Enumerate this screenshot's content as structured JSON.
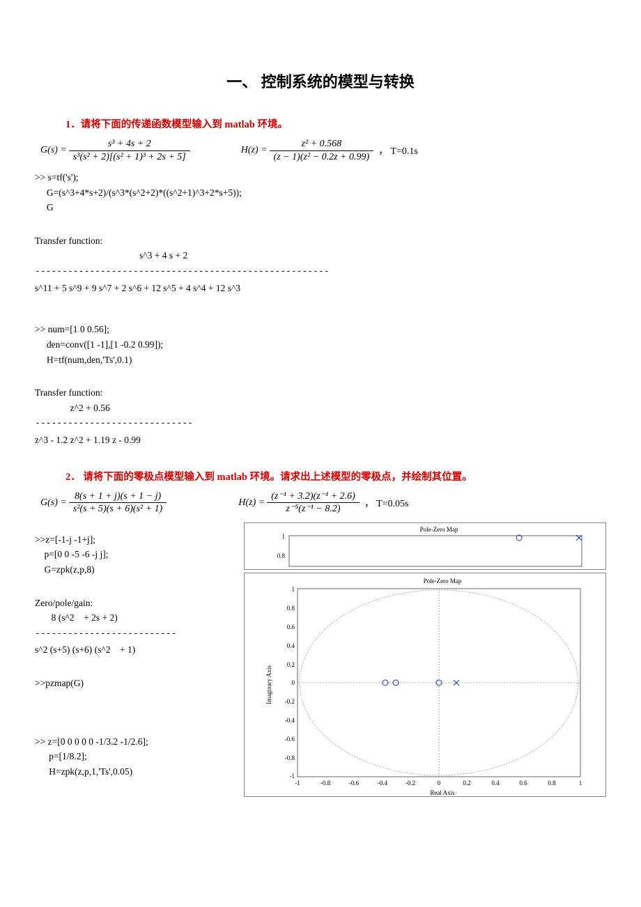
{
  "title": "一、 控制系统的模型与转换",
  "section1": {
    "heading": "1．请将下面的传递函数模型输入到 matlab 环境。",
    "eqG_lhs": "G(s) = ",
    "eqG_num": "s³ + 4s + 2",
    "eqG_den": "s³(s² + 2)[(s² + 1)³ + 2s + 5]",
    "eqH_lhs": "H(z) = ",
    "eqH_num": "z² + 0.568",
    "eqH_den": "(z − 1)(z² − 0.2z + 0.99)",
    "eqH_tail": "，  T=0.1s",
    "code1_l1": ">> s=tf('s');",
    "code1_l2": "     G=(s^3+4*s+2)/(s^3*(s^2+2)*((s^2+1)^3+2*s+5));",
    "code1_l3": "     G",
    "tf1_label": "Transfer function:",
    "tf1_num": "s^3 + 4 s + 2",
    "tf1_sep": "------------------------------------------------------",
    "tf1_den": "s^11 + 5 s^9 + 9 s^7 + 2 s^6 + 12 s^5 + 4 s^4 + 12 s^3",
    "code2_l1": ">> num=[1 0 0.56];",
    "code2_l2": "     den=conv([1 -1],[1 -0.2 0.99]);",
    "code2_l3": "     H=tf(num,den,'Ts',0.1)",
    "tf2_label": "Transfer function:",
    "tf2_num": "z^2 + 0.56",
    "tf2_num_pad": "               ",
    "tf2_sep": "-----------------------------",
    "tf2_den": "z^3 - 1.2 z^2 + 1.19 z - 0.99"
  },
  "section2": {
    "heading": "2． 请将下面的零极点模型输入到 matlab 环境。请求出上述模型的零极点，并绘制其位置。",
    "eqG_lhs": "G(s) = ",
    "eqG_num": "8(s + 1 + j)(s + 1 − j)",
    "eqG_den": "s²(s + 5)(s + 6)(s² + 1)",
    "eqH_lhs": "H(z) = ",
    "eqH_num": "(z⁻¹ + 3.2)(z⁻¹ + 2.6)",
    "eqH_den": "z⁻⁵(z⁻¹ − 8.2)",
    "eqH_tail": "，  T=0.05s",
    "code1_l1": ">>z=[-1-j -1+j];",
    "code1_l2": "    p=[0 0 -5 -6 -j j];",
    "code1_l3": "    G=zpk(z,p,8)",
    "zpg_label": "Zero/pole/gain:",
    "zpg_num": "       8 (s^2    + 2s + 2)",
    "zpg_sep": "--------------------------",
    "zpg_den": "s^2 (s+5) (s+6) (s^2    + 1)",
    "pzmap": ">>pzmap(G)",
    "code2_l1": ">> z=[0 0 0 0 0 -1/3.2 -1/2.6];",
    "code2_l2": "      p=[1/8.2];",
    "code2_l3": "      H=zpk(z,p,1,'Ts',0.05)",
    "plot1_title": "Pole-Zero Map",
    "plot2_title": "Pole-Zero Map",
    "plot2_xlabel": "Real Axis",
    "plot2_ylabel": "Imaginary Axis",
    "plot1_yticks": [
      "1",
      "0.8"
    ],
    "plot2_xticks": [
      "-1",
      "-0.8",
      "-0.6",
      "-0.4",
      "-0.2",
      "0",
      "0.2",
      "0.4",
      "0.6",
      "0.8",
      "1"
    ],
    "plot2_yticks": [
      "1",
      "0.8",
      "0.6",
      "0.4",
      "0.2",
      "0",
      "-0.2",
      "-0.4",
      "-0.6",
      "-0.8",
      "-1"
    ]
  },
  "chart_data": [
    {
      "type": "scatter",
      "title": "Pole-Zero Map",
      "note": "top cropped strip",
      "zeros": [
        [
          0.6,
          1.0
        ]
      ],
      "poles": [
        [
          0.98,
          1.0
        ]
      ],
      "yticks": [
        1,
        0.8
      ]
    },
    {
      "type": "scatter",
      "title": "Pole-Zero Map",
      "xlabel": "Real Axis",
      "ylabel": "Imaginary Axis",
      "xlim": [
        -1,
        1
      ],
      "ylim": [
        -1,
        1
      ],
      "unit_circle": true,
      "zeros": [
        [
          -0.38,
          0
        ],
        [
          -0.31,
          0
        ],
        [
          0.0,
          0
        ]
      ],
      "poles": [
        [
          0.12,
          0
        ]
      ]
    }
  ]
}
